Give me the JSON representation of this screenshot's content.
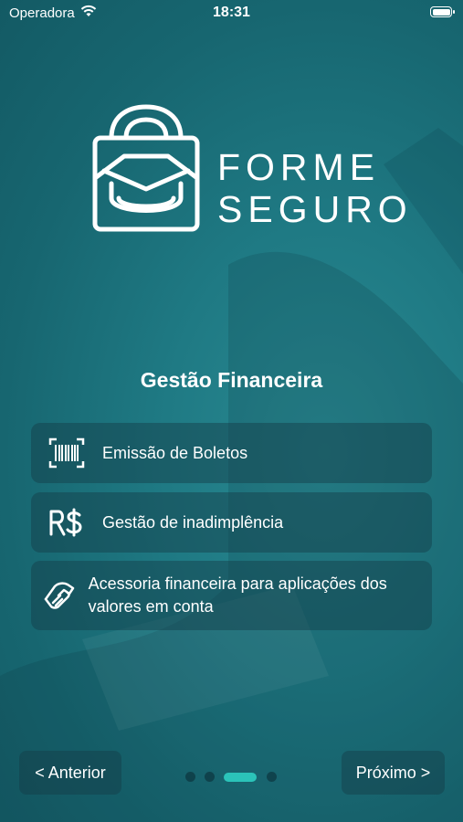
{
  "status_bar": {
    "carrier": "Operadora",
    "time": "18:31"
  },
  "logo": {
    "line1": "FORME",
    "line2": "SEGURO"
  },
  "section": {
    "title": "Gestão Financeira"
  },
  "features": [
    {
      "icon": "barcode-icon",
      "label": "Emissão de Boletos"
    },
    {
      "icon": "currency-real-icon",
      "label": "Gestão de inadimplência"
    },
    {
      "icon": "handshake-icon",
      "label": "Acessoria financeira para aplicações dos valores em conta"
    }
  ],
  "navigation": {
    "prev_label": "< Anterior",
    "next_label": "Próximo >",
    "page_count": 4,
    "current_page": 3
  },
  "colors": {
    "accent": "#2bc3b9",
    "background": "#1f7a84"
  }
}
